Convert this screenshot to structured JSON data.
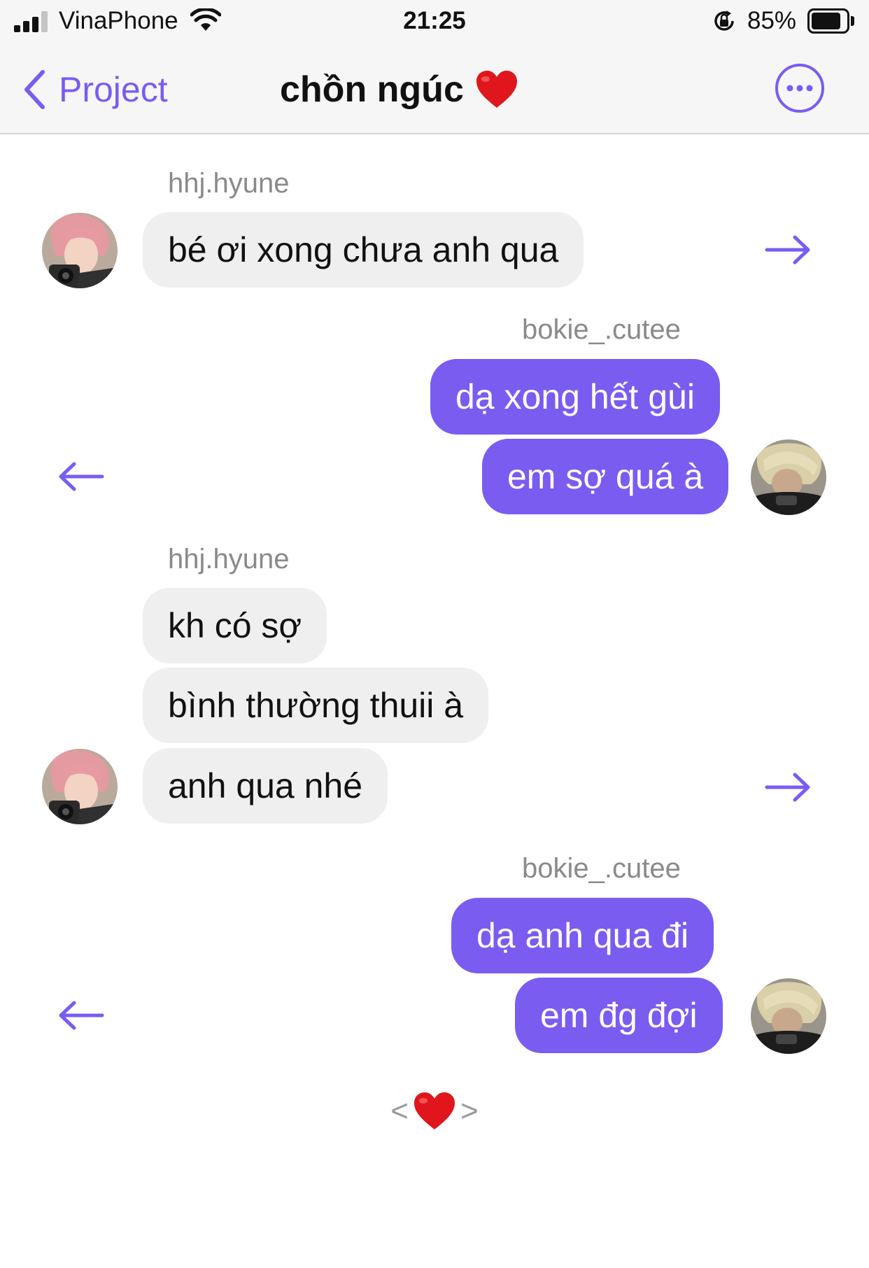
{
  "status_bar": {
    "carrier": "VinaPhone",
    "time": "21:25",
    "battery_percent": "85%",
    "battery_level": 0.85,
    "signal_bars": 3
  },
  "nav": {
    "back_label": "Project",
    "title": "chồn ngúc",
    "title_emoji": "heart-icon"
  },
  "messages": [
    {
      "sender": "hhj.hyune",
      "side": "incoming",
      "bubbles": [
        "bé ơi xong chưa anh qua"
      ]
    },
    {
      "sender": "bokie_.cutee",
      "side": "outgoing",
      "bubbles": [
        "dạ xong hết gùi",
        "em sợ quá à"
      ]
    },
    {
      "sender": "hhj.hyune",
      "side": "incoming",
      "bubbles": [
        "kh có sợ",
        "bình thường thuii à",
        "anh qua nhé"
      ]
    },
    {
      "sender": "bokie_.cutee",
      "side": "outgoing",
      "bubbles": [
        "dạ anh qua đi",
        "em đg đợi"
      ]
    }
  ],
  "pager": {
    "prev": "<",
    "next": ">"
  },
  "colors": {
    "accent": "#7a5cf0",
    "incoming_bubble": "#efeff0",
    "outgoing_bubble": "#7a5cf0",
    "heart": "#e0161c"
  }
}
